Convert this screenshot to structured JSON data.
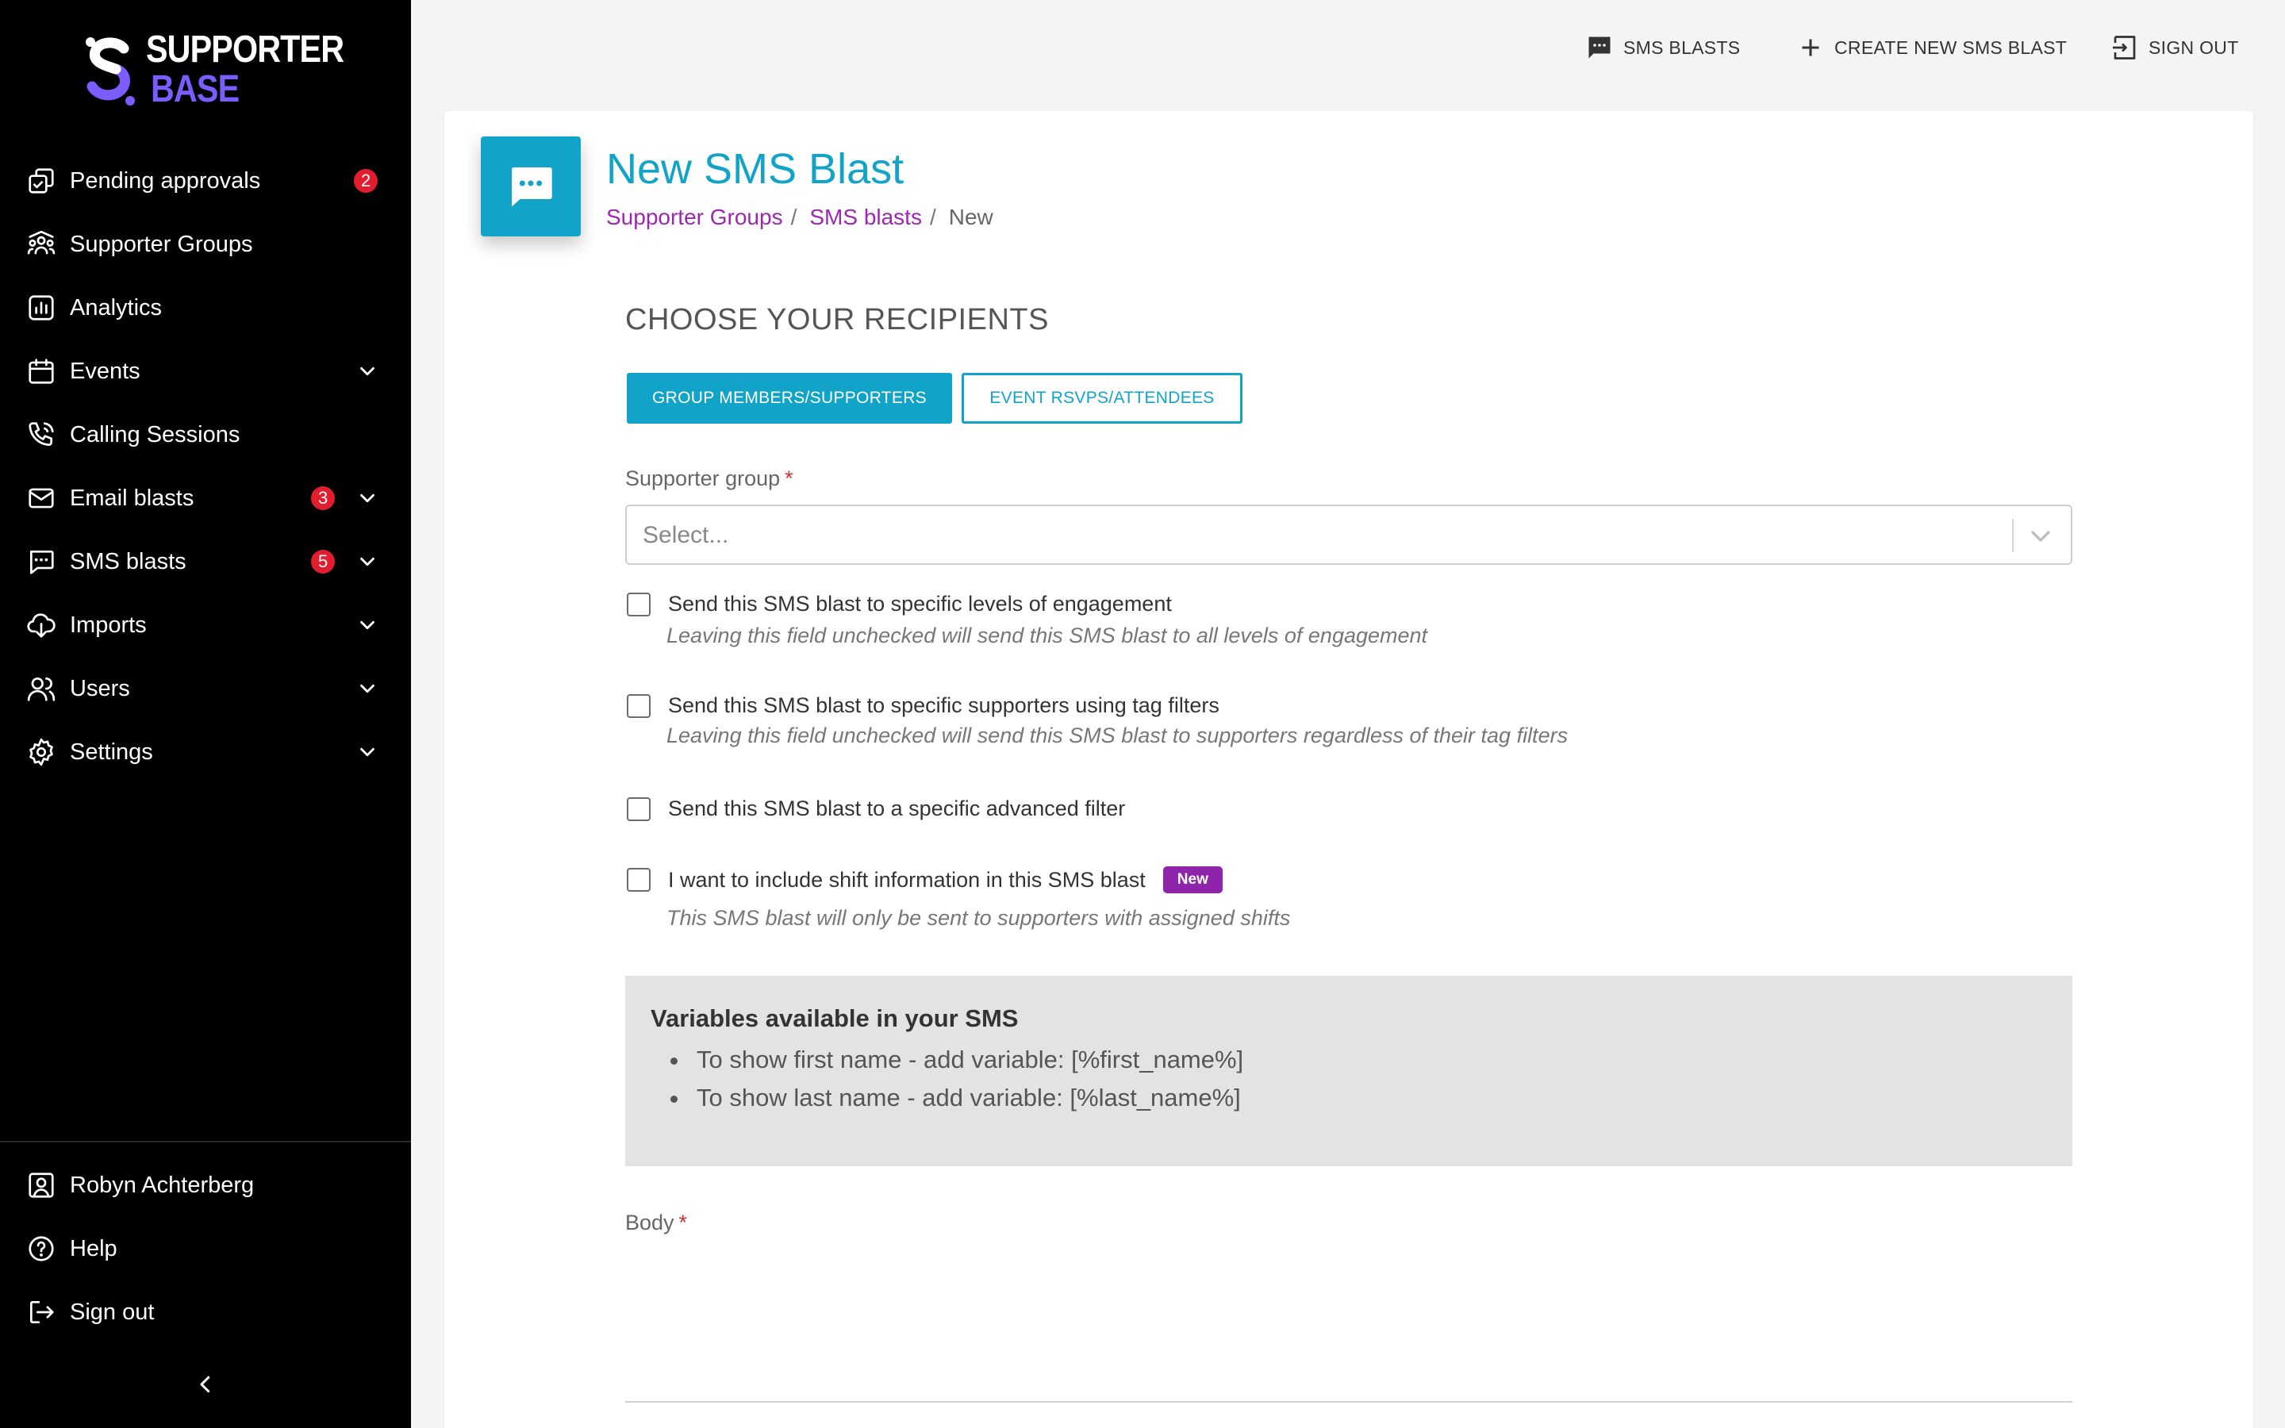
{
  "brand": {
    "line1": "SUPPORTER",
    "line2": "BASE",
    "accent": "#7b5cff"
  },
  "sidebar": {
    "items": [
      {
        "label": "Pending approvals",
        "icon": "approvals-icon",
        "badge": "2",
        "chevron": false
      },
      {
        "label": "Supporter Groups",
        "icon": "groups-icon",
        "badge": "",
        "chevron": false
      },
      {
        "label": "Analytics",
        "icon": "analytics-icon",
        "badge": "",
        "chevron": false
      },
      {
        "label": "Events",
        "icon": "calendar-icon",
        "badge": "",
        "chevron": true
      },
      {
        "label": "Calling Sessions",
        "icon": "phone-icon",
        "badge": "",
        "chevron": false
      },
      {
        "label": "Email blasts",
        "icon": "mail-icon",
        "badge": "3",
        "chevron": true
      },
      {
        "label": "SMS blasts",
        "icon": "sms-icon",
        "badge": "5",
        "chevron": true
      },
      {
        "label": "Imports",
        "icon": "import-icon",
        "badge": "",
        "chevron": true
      },
      {
        "label": "Users",
        "icon": "users-icon",
        "badge": "",
        "chevron": true
      },
      {
        "label": "Settings",
        "icon": "gear-icon",
        "badge": "",
        "chevron": true
      }
    ],
    "bottom": [
      {
        "label": "Robyn Achterberg",
        "icon": "account-icon"
      },
      {
        "label": "Help",
        "icon": "help-icon"
      },
      {
        "label": "Sign out",
        "icon": "logout-icon"
      }
    ]
  },
  "topbar": {
    "sms_blasts": "SMS BLASTS",
    "create_new": "CREATE NEW SMS BLAST",
    "sign_out": "SIGN OUT"
  },
  "page": {
    "title": "New SMS Blast",
    "breadcrumb": [
      "Supporter Groups",
      "SMS blasts",
      "New"
    ],
    "accent": "#12a3c8",
    "link_color": "#9c27b0"
  },
  "form": {
    "section_title": "CHOOSE YOUR RECIPIENTS",
    "tab_group": "GROUP MEMBERS/SUPPORTERS",
    "tab_event": "EVENT RSVPS/ATTENDEES",
    "supporter_group_label": "Supporter group",
    "required_mark": "*",
    "select_placeholder": "Select...",
    "checkboxes": [
      {
        "label": "Send this SMS blast to specific levels of engagement",
        "help": "Leaving this field unchecked will send this SMS blast to all levels of engagement",
        "checked": false
      },
      {
        "label": "Send this SMS blast to specific supporters using tag filters",
        "help": "Leaving this field unchecked will send this SMS blast to supporters regardless of their tag filters",
        "checked": false
      },
      {
        "label": "Send this SMS blast to a specific advanced filter",
        "help": "",
        "checked": false
      },
      {
        "label": "I want to include shift information in this SMS blast",
        "help": "This SMS blast will only be sent to supporters with assigned shifts",
        "checked": false,
        "badge": "New"
      }
    ],
    "variables": {
      "title": "Variables available in your SMS",
      "items": [
        "To show first name - add variable: [%first_name%]",
        "To show last name - add variable: [%last_name%]"
      ]
    },
    "body_label": "Body"
  }
}
